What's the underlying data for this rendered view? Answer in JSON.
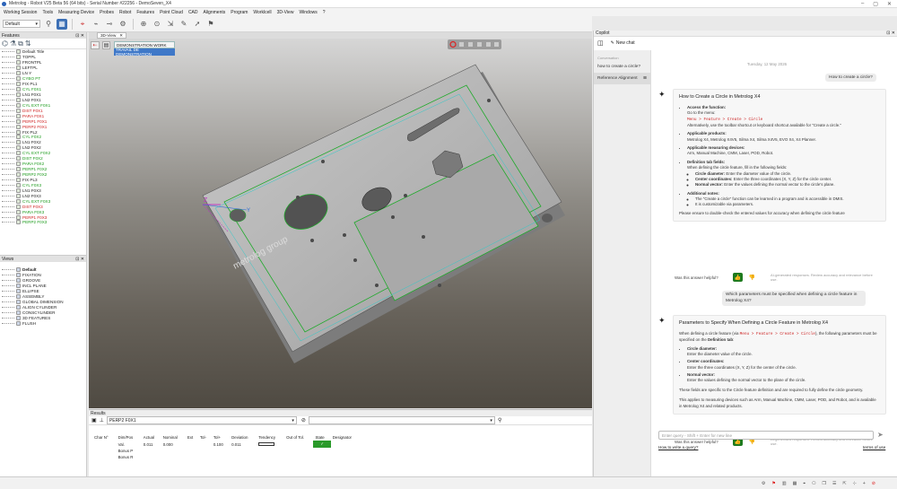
{
  "window": {
    "title": "Metrolog - Robot V25 Beta 56 (64 bits) - Serial Number #22256 - DemoSeven_X4",
    "minimize": "–",
    "maximize": "▢",
    "close": "✕"
  },
  "menu": [
    "Working Session",
    "Tools",
    "Measuring Device",
    "Probes",
    "Robot",
    "Features",
    "Point Cloud",
    "CAD",
    "Alignments",
    "Program",
    "Worklcell",
    "3D-View",
    "Windows",
    "?"
  ],
  "toolbar": {
    "default_combo": "Default"
  },
  "features_panel": {
    "title": "Features",
    "items": [
      {
        "label": "Default Title",
        "c": "k"
      },
      {
        "label": "TOPPL",
        "c": "k"
      },
      {
        "label": "FRONTPL",
        "c": "k"
      },
      {
        "label": "LEFTPL",
        "c": "k"
      },
      {
        "label": "LN Y",
        "c": "k"
      },
      {
        "label": "CYBO PT",
        "c": "g"
      },
      {
        "label": "FIX PL1",
        "c": "k"
      },
      {
        "label": "CYL F0X1",
        "c": "g"
      },
      {
        "label": "LN1 F0X1",
        "c": "k"
      },
      {
        "label": "LN2 F0X1",
        "c": "k"
      },
      {
        "label": "CYL EXT F0X1",
        "c": "g"
      },
      {
        "label": "DIST F0X1",
        "c": "r"
      },
      {
        "label": "PARA F0X1",
        "c": "r"
      },
      {
        "label": "PERP1 F0X1",
        "c": "r"
      },
      {
        "label": "PERP2 F0X1",
        "c": "r"
      },
      {
        "label": "FIX PL2",
        "c": "k"
      },
      {
        "label": "CYL F0X2",
        "c": "g"
      },
      {
        "label": "LN1 F0X2",
        "c": "k"
      },
      {
        "label": "LN2 F0X2",
        "c": "k"
      },
      {
        "label": "CYL EXT F0X2",
        "c": "g"
      },
      {
        "label": "DIST F0X2",
        "c": "g"
      },
      {
        "label": "PARA F0X2",
        "c": "g"
      },
      {
        "label": "PERP1 F0X2",
        "c": "g"
      },
      {
        "label": "PERP2 F0X2",
        "c": "g"
      },
      {
        "label": "FIX PL3",
        "c": "k"
      },
      {
        "label": "CYL F0X3",
        "c": "g"
      },
      {
        "label": "LN1 F0X3",
        "c": "k"
      },
      {
        "label": "LN2 F0X3",
        "c": "k"
      },
      {
        "label": "CYL EXT F0X3",
        "c": "g"
      },
      {
        "label": "DIST F0X3",
        "c": "r"
      },
      {
        "label": "PARA F0X3",
        "c": "g"
      },
      {
        "label": "PERP1 F0X3",
        "c": "r"
      },
      {
        "label": "PERP2 F0X3",
        "c": "g"
      }
    ]
  },
  "views_panel": {
    "title": "Views",
    "items": [
      "Default",
      "FIXATION",
      "GROOVE",
      "INCL PLANE",
      "ELLIPSE",
      "ASSEMBLY",
      "GLOBAL DIMENSION",
      "ALIGN CYLINDER",
      "CONSCYLINDER",
      "3D FEATURES",
      "FLUSH"
    ]
  },
  "view3d": {
    "tab": "3D-View",
    "close": "✕",
    "demo": [
      "DEMONSTRATION WORK",
      "TRAVAIL DE DEMONSTRATION"
    ],
    "engraving": "metrolog group",
    "axis_y": "Y",
    "axis_z": "Z"
  },
  "results": {
    "title": "Results",
    "feature": "PERP2 F0X1",
    "headers": [
      "Char N°",
      "Dim/Pos",
      "Actual",
      "Nominal",
      "Ext",
      "Tol-",
      "Tol+",
      "Deviation",
      "Tendency",
      "Out of Tol.",
      "State",
      "Designator"
    ],
    "rows": [
      [
        "",
        "Val.",
        "0.011",
        "0.000",
        "",
        "",
        "0.100",
        "0.011",
        "",
        "",
        "✓",
        ""
      ],
      [
        "",
        "Bonus P",
        "",
        "",
        "",
        "",
        "",
        "",
        "",
        "",
        "",
        ""
      ],
      [
        "",
        "Bonus R",
        "",
        "",
        "",
        "",
        "",
        "",
        "",
        "",
        "",
        ""
      ]
    ]
  },
  "copilot": {
    "title": "Copilot",
    "new_chat": "New chat",
    "history_label": "Conversation",
    "history": [
      "how to create a circle?",
      "Reference Alignment"
    ],
    "date": "Tuesday, 12 May 2026",
    "q1": "How to create a circle?",
    "a1": {
      "title": "How to Create a Circle in Metrolog X4",
      "s1": "Access the function:",
      "s1a": "Go to the menu:",
      "s1p": "Menu > Feature > Create > Circle",
      "s1b": "Alternatively, use the toolbar shortcut or keyboard shortcut available for \"Create a circle.\"",
      "s2": "Applicable products:",
      "s2a": "Metrolog X4, Metrolog X4V5, Silma X4, Silma X4V5, EVO X4, X4 Planner.",
      "s3": "Applicable measuring devices:",
      "s3a": "Arm, Manual Machine, CMM, Laser, POD, Robot.",
      "s4": "Definition tab fields:",
      "s4a": "When defining the circle feature, fill in the following fields:",
      "f1": "Circle diameter:",
      "f1a": "Enter the diameter value of the circle.",
      "f2": "Center coordinates:",
      "f2a": "Enter the three coordinates (X, Y, Z) for the circle center.",
      "f3": "Normal vector:",
      "f3a": "Enter the values defining the normal vector to the circle's plane.",
      "s5": "Additional notes:",
      "n1": "The \"Create a circle\" function can be learned in a program and is accessible in DMIS.",
      "n2": "It is customizable via parameters.",
      "end": "Please ensure to double-check the entered values for accuracy when defining the circle feature"
    },
    "helpful": "Was this answer helpful?",
    "disclaimer": "AI-generated responses. Review accuracy and relevance before use.",
    "q2": "Which parameters must be specified when defining a circle feature in Metrolog X4?",
    "a2": {
      "title": "Parameters to Specify When Defining a Circle Feature in Metrolog X4",
      "intro1": "When defining a circle feature (via ",
      "path": "Menu > Feature > Create > Circle",
      "intro2": "), the following parameters must be specified on the ",
      "tab": "Definition tab",
      ":": ":",
      "p1": "Circle diameter:",
      "p1a": "Enter the diameter value of the circle.",
      "p2": "Center coordinates:",
      "p2a": "Enter the three coordinates (X, Y, Z) for the center of the circle.",
      "p3": "Normal vector:",
      "p3a": "Enter the values defining the normal vector to the plane of the circle.",
      "mid": "These fields are specific to the Circle feature definition and are required to fully define the circle geometry.",
      "end": "This applies to measuring devices such as Arm, Manual Machine, CMM, Laser, POD, and Robot, and is available in Metrolog X4 and related products."
    },
    "input_placeholder": "Enter query - Shift + Enter for new line",
    "link_write": "How to write a query?",
    "link_terms": "terms of use"
  }
}
